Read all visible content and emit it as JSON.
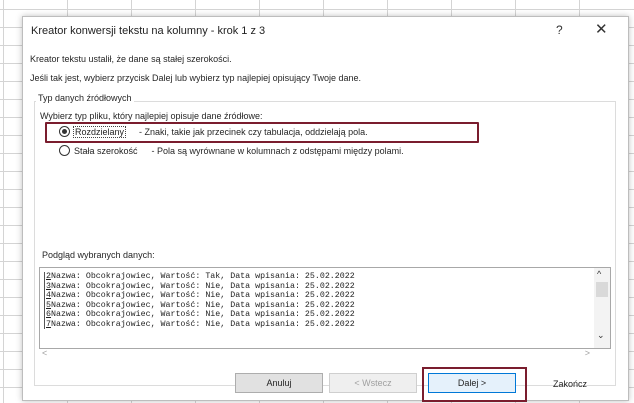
{
  "dialog": {
    "title": "Kreator konwersji tekstu na kolumny - krok 1 z 3",
    "help": "?",
    "close": "✕",
    "intro": "Kreator tekstu ustalił, że dane są stałej szerokości.",
    "instruction": "Jeśli tak jest, wybierz przycisk Dalej lub wybierz typ najlepiej opisujący Twoje dane.",
    "group_title": "Typ danych źródłowych",
    "group_subtitle": "Wybierz typ pliku, który najlepiej opisuje dane źródłowe:",
    "options": [
      {
        "label": "Rozdzielany",
        "desc": "- Znaki, takie jak przecinek czy tabulacja, oddzielają pola.",
        "selected": true
      },
      {
        "label": "Stała szerokość",
        "desc": "- Pola są wyrównane w kolumnach z odstępami między polami.",
        "selected": false
      }
    ],
    "preview_label": "Podgląd wybranych danych:",
    "preview_rows": [
      {
        "num": "2",
        "text": "Nazwa: Obcokrajowiec, Wartość: Tak, Data wpisania: 25.02.2022"
      },
      {
        "num": "3",
        "text": "Nazwa: Obcokrajowiec, Wartość: Nie, Data wpisania: 25.02.2022"
      },
      {
        "num": "4",
        "text": "Nazwa: Obcokrajowiec, Wartość: Nie, Data wpisania: 25.02.2022"
      },
      {
        "num": "5",
        "text": "Nazwa: Obcokrajowiec, Wartość: Nie, Data wpisania: 25.02.2022"
      },
      {
        "num": "6",
        "text": "Nazwa: Obcokrajowiec, Wartość: Nie, Data wpisania: 25.02.2022"
      },
      {
        "num": "7",
        "text": "Nazwa: Obcokrajowiec, Wartość: Nie, Data wpisania: 25.02.2022"
      }
    ],
    "scroll": {
      "up": "^",
      "down": "⌄",
      "left": "<",
      "right": ">"
    },
    "buttons": {
      "cancel": "Anuluj",
      "back": "< Wstecz",
      "next": "Dalej >",
      "finish": "Zakończ"
    }
  },
  "colors": {
    "highlight": "#7a1d2e",
    "primary_border": "#0078d7"
  }
}
